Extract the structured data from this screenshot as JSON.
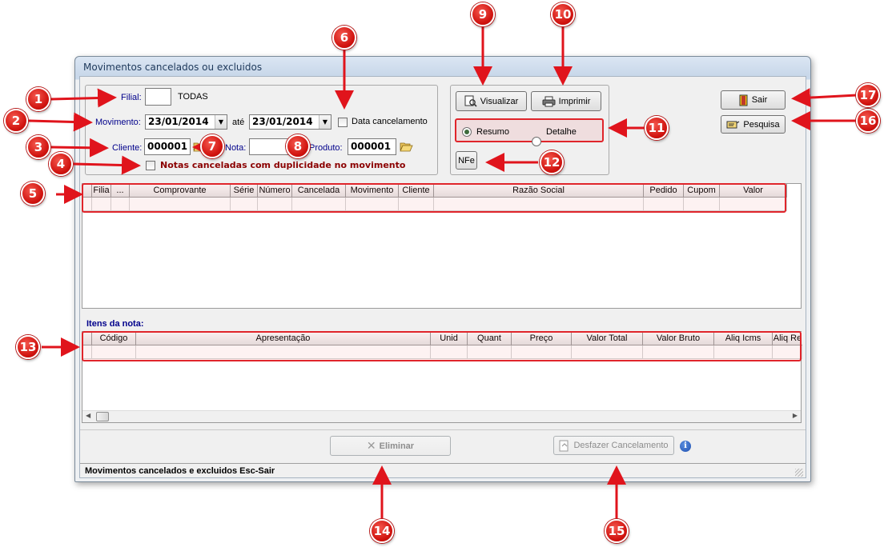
{
  "window": {
    "title": "Movimentos cancelados ou excluidos"
  },
  "filters": {
    "filial_label": "Filial:",
    "filial_value": "",
    "filial_desc": "TODAS",
    "movimento_label": "Movimento:",
    "date_from": "23/01/2014",
    "ate_label": "até",
    "date_to": "23/01/2014",
    "data_cancelamento_label": "Data cancelamento",
    "data_cancelamento_checked": false,
    "cliente_label": "Cliente:",
    "cliente_value": "000001",
    "nota_label": "Nota:",
    "nota_value": "",
    "produto_label": "Produto:",
    "produto_value": "000001",
    "duplicidade_label": "Notas canceladas com duplicidade no movimento",
    "duplicidade_checked": false
  },
  "actions": {
    "visualizar_label": "Visualizar",
    "imprimir_label": "Imprimir",
    "resumo_label": "Resumo",
    "detalhe_label": "Detalhe",
    "selected_mode": "Resumo",
    "nfe_label": "NFe",
    "sair_label": "Sair",
    "pesquisa_label": "Pesquisa"
  },
  "movements_grid": {
    "columns": [
      "Filia",
      "...",
      "Comprovante",
      "Série",
      "Número",
      "Cancelada",
      "Movimento",
      "Cliente",
      "Razão Social",
      "Pedido",
      "Cupom",
      "Valor"
    ]
  },
  "items_section": {
    "title": "Itens da nota:",
    "columns": [
      "Código",
      "Apresentação",
      "Unid",
      "Quant",
      "Preço",
      "Valor Total",
      "Valor Bruto",
      "Aliq Icms",
      "Aliq Re"
    ]
  },
  "bottom": {
    "eliminar_label": "Eliminar",
    "desfazer_label": "Desfazer Cancelamento"
  },
  "statusbar": {
    "text": "Movimentos cancelados e excluidos  Esc-Sair"
  },
  "callouts": [
    "1",
    "2",
    "3",
    "4",
    "5",
    "6",
    "7",
    "8",
    "9",
    "10",
    "11",
    "12",
    "13",
    "14",
    "15",
    "16",
    "17"
  ],
  "colors": {
    "callout_red": "#d0130f",
    "label_blue": "#00008b",
    "duplicidade_red": "#8b0000"
  }
}
